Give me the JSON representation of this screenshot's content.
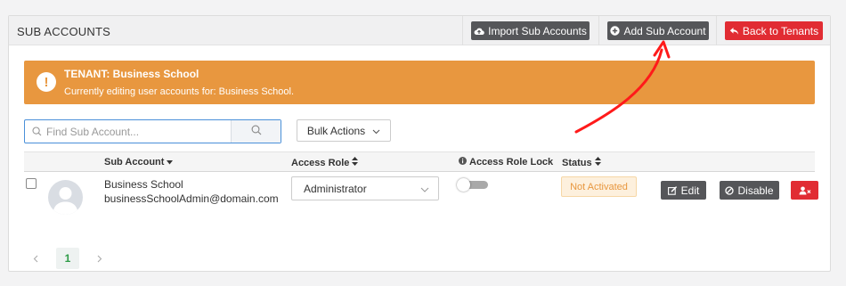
{
  "header": {
    "title": "SUB ACCOUNTS",
    "import_label": "Import Sub Accounts",
    "add_label": "Add Sub Account",
    "back_label": "Back to Tenants"
  },
  "alert": {
    "title": "TENANT: Business School",
    "text": "Currently editing user accounts for: Business School."
  },
  "search": {
    "placeholder": "Find Sub Account...",
    "value": ""
  },
  "bulk": {
    "label": "Bulk Actions"
  },
  "table": {
    "columns": {
      "sub_account": "Sub Account",
      "access_role": "Access Role",
      "access_role_lock": "Access Role Lock",
      "status": "Status"
    },
    "rows": [
      {
        "name": "Business School",
        "email": "businessSchoolAdmin@domain.com",
        "role": "Administrator",
        "role_lock": false,
        "status": "Not Activated",
        "edit_label": "Edit",
        "disable_label": "Disable"
      }
    ]
  },
  "pagination": {
    "current": "1"
  },
  "colors": {
    "accent_orange": "#e8973f",
    "danger_red": "#e12c33",
    "dark_button": "#555659",
    "focus_blue": "#4a90d9",
    "active_page_green": "#2e9b47",
    "annotation_arrow": "#ff1a1a"
  },
  "icons": {
    "import": "cloud-upload-icon",
    "add": "plus-circle-icon",
    "back": "reply-arrow-icon",
    "alert": "exclamation-icon",
    "search": "magnifier-icon",
    "bulk": "chevron-down-icon",
    "sort": "sort-caret-icon",
    "info": "info-circle-icon",
    "edit": "edit-icon",
    "disable": "ban-icon",
    "delete": "user-remove-icon"
  }
}
